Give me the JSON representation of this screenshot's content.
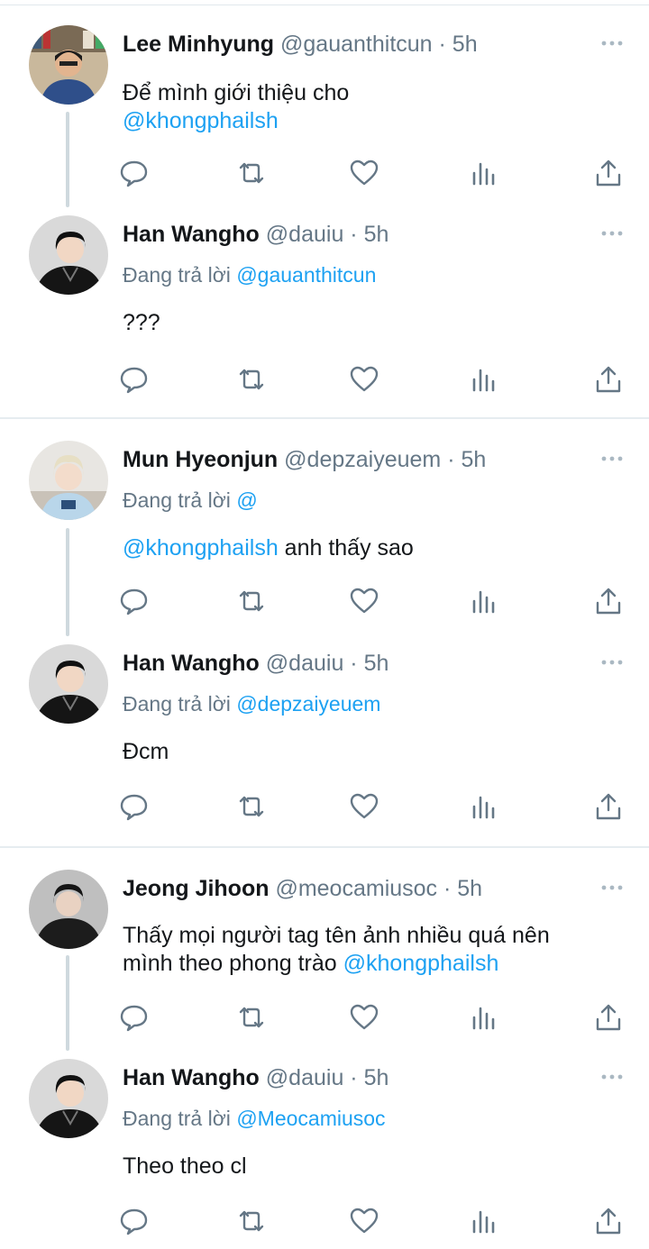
{
  "threads": [
    {
      "tweets": [
        {
          "name": "Lee Minhyung",
          "handle": "@gauanthitcun",
          "time": "5h",
          "replying_prefix": "",
          "replying_to": "",
          "text_line1": "Để mình giới thiệu cho",
          "text_line1_link": "",
          "text_line2_link": "@khongphailsh",
          "text_line2": ""
        },
        {
          "name": "Han Wangho",
          "handle": "@dauiu",
          "time": "5h",
          "replying_prefix": "Đang trả lời ",
          "replying_to": "@gauanthitcun",
          "text_line1": "???",
          "text_line1_link": "",
          "text_line2_link": "",
          "text_line2": ""
        }
      ]
    },
    {
      "tweets": [
        {
          "name": "Mun Hyeonjun",
          "handle": "@depzaiyeuem",
          "time": "5h",
          "replying_prefix": "Đang trả lời ",
          "replying_to": "@",
          "text_line1_link": "@khongphailsh",
          "text_line1": " anh thấy sao",
          "text_line2_link": "",
          "text_line2": ""
        },
        {
          "name": "Han Wangho",
          "handle": "@dauiu",
          "time": "5h",
          "replying_prefix": "Đang trả lời ",
          "replying_to": "@depzaiyeuem",
          "text_line1": "Đcm",
          "text_line1_link": "",
          "text_line2_link": "",
          "text_line2": ""
        }
      ]
    },
    {
      "tweets": [
        {
          "name": "Jeong Jihoon",
          "handle": "@meocamiusoc",
          "time": "5h",
          "replying_prefix": "",
          "replying_to": "",
          "text_line1": "Thấy mọi người tag tên ảnh nhiều quá nên",
          "text_line1_link": "",
          "text_line2": "mình theo phong trào ",
          "text_line2_link": "@khongphailsh"
        },
        {
          "name": "Han Wangho",
          "handle": "@dauiu",
          "time": "5h",
          "replying_prefix": "Đang trả lời ",
          "replying_to": "@Meocamiusoc",
          "text_line1": "Theo theo cl",
          "text_line1_link": "",
          "text_line2_link": "",
          "text_line2": ""
        }
      ]
    }
  ],
  "separator": " · ",
  "icons": {
    "reply": "reply-icon",
    "retweet": "retweet-icon",
    "like": "heart-icon",
    "analytics": "analytics-icon",
    "share": "share-icon",
    "more": "more-icon"
  },
  "colors": {
    "link": "#1da1f2",
    "muted": "#657786",
    "thread_line": "#cfd9de",
    "separator": "#e6ecf0"
  }
}
